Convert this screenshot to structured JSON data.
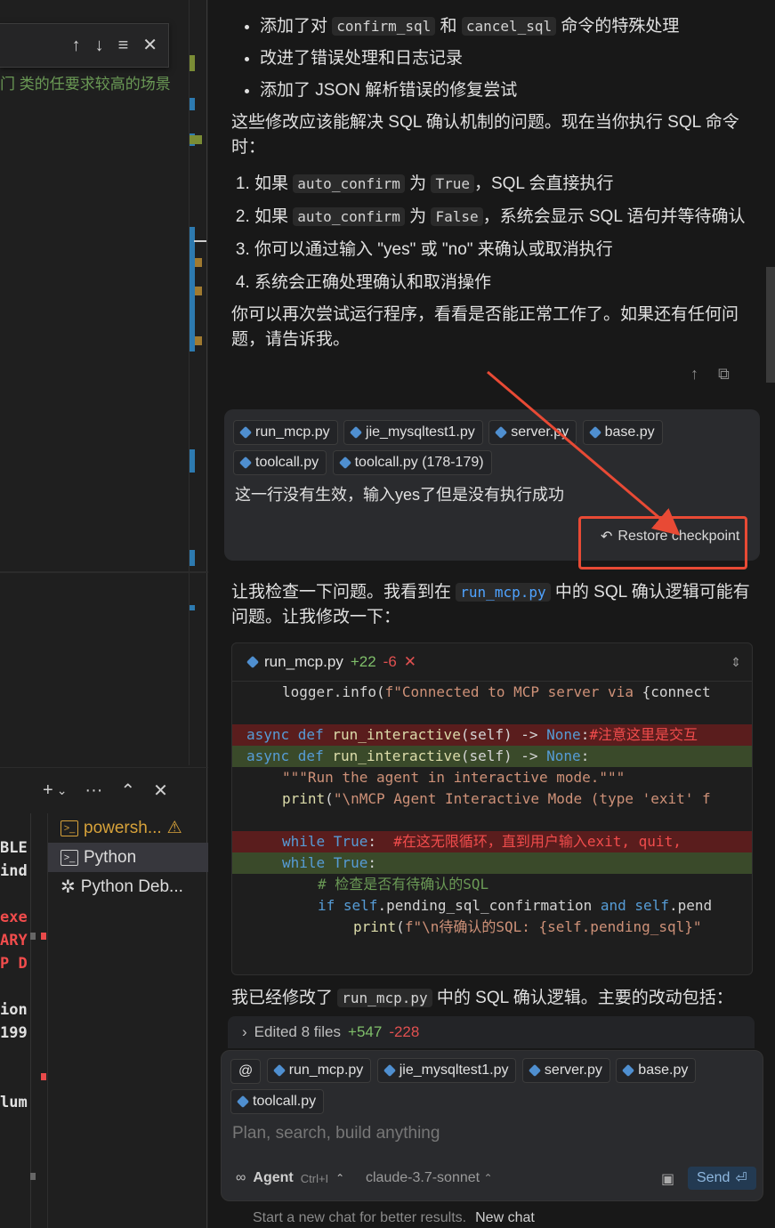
{
  "editor": {
    "snippet": "门 类的任要求较高的场景",
    "find_bar": {
      "up": "↑",
      "down": "↓",
      "menu": "≡",
      "close": "✕"
    },
    "terminal_toolbar": {
      "add": "+",
      "dropdown": "⌄",
      "more": "···",
      "maximize": "⌃",
      "close": "✕"
    },
    "terminal_lines": [
      {
        "text": "BLE",
        "color": "#e0e0e0"
      },
      {
        "text": "ind",
        "color": "#e0e0e0"
      },
      {
        "text": "",
        "color": "#e0e0e0"
      },
      {
        "text": "exe",
        "color": "#f14c4c"
      },
      {
        "text": "ARY",
        "color": "#f14c4c"
      },
      {
        "text": "P D",
        "color": "#f14c4c"
      },
      {
        "text": "",
        "color": "#e0e0e0"
      },
      {
        "text": "ion",
        "color": "#e0e0e0"
      },
      {
        "text": "199",
        "color": "#e0e0e0"
      },
      {
        "text": "",
        "color": "#e0e0e0"
      },
      {
        "text": "",
        "color": "#e0e0e0"
      },
      {
        "text": "lum",
        "color": "#e0e0e0"
      }
    ],
    "terminals": [
      {
        "label": "powersh...",
        "warning": "⚠"
      },
      {
        "label": "Python"
      },
      {
        "label": "Python Deb..."
      }
    ]
  },
  "chat": {
    "bullets": [
      {
        "pre": "添加了对 ",
        "code1": "confirm_sql",
        "mid": " 和 ",
        "code2": "cancel_sql",
        "post": " 命令的特殊处理"
      },
      {
        "text": "改进了错误处理和日志记录"
      },
      {
        "text": "添加了 JSON 解析错误的修复尝试"
      }
    ],
    "para1": "这些修改应该能解决 SQL 确认机制的问题。现在当你执行 SQL 命令时：",
    "steps": [
      {
        "pre": "如果 ",
        "code1": "auto_confirm",
        "mid": " 为 ",
        "code2": "True",
        "post": "，SQL 会直接执行"
      },
      {
        "pre": "如果 ",
        "code1": "auto_confirm",
        "mid": " 为 ",
        "code2": "False",
        "post": "，系统会显示 SQL 语句并等待确认"
      },
      {
        "text": "你可以通过输入 \"yes\" 或 \"no\" 来确认或取消执行"
      },
      {
        "text": "系统会正确处理确认和取消操作"
      }
    ],
    "para2": "你可以再次尝试运行程序，看看是否能正常工作了。如果还有任何问题，请告诉我。",
    "user_message": {
      "files": [
        "run_mcp.py",
        "jie_mysqltest1.py",
        "server.py",
        "base.py",
        "toolcall.py",
        "toolcall.py (178-179)"
      ],
      "text": "这一行没有生效，输入yes了但是没有执行成功",
      "restore": "Restore checkpoint"
    },
    "reply_pre": "让我检查一下问题。我看到在 ",
    "reply_code": "run_mcp.py",
    "reply_post": " 中的 SQL 确认逻辑可能有问题。让我修改一下：",
    "diff": {
      "file": "run_mcp.py",
      "added": "+22",
      "removed": "-6",
      "lines": [
        {
          "type": "ctx",
          "indent": "    ",
          "parts": [
            {
              "c": "",
              "t": "logger.info("
            },
            {
              "c": "str",
              "t": "f\"Connected to MCP server via "
            },
            {
              "c": "",
              "t": "{connect"
            }
          ]
        },
        {
          "type": "ctx",
          "indent": "",
          "parts": []
        },
        {
          "type": "rm",
          "indent": "",
          "parts": [
            {
              "c": "kw",
              "t": "async def "
            },
            {
              "c": "fn",
              "t": "run_interactive"
            },
            {
              "c": "",
              "t": "(self) -> "
            },
            {
              "c": "kw",
              "t": "None"
            },
            {
              "c": "",
              "t": ":"
            },
            {
              "c": "cm-red",
              "t": "#注意这里是交互"
            }
          ]
        },
        {
          "type": "ad",
          "indent": "",
          "parts": [
            {
              "c": "kw",
              "t": "async def "
            },
            {
              "c": "fn",
              "t": "run_interactive"
            },
            {
              "c": "",
              "t": "(self) -> "
            },
            {
              "c": "kw",
              "t": "None"
            },
            {
              "c": "",
              "t": ":"
            }
          ]
        },
        {
          "type": "ctx",
          "indent": "    ",
          "parts": [
            {
              "c": "str",
              "t": "\"\"\"Run the agent in interactive mode.\"\"\""
            }
          ]
        },
        {
          "type": "ctx",
          "indent": "    ",
          "parts": [
            {
              "c": "fn",
              "t": "print"
            },
            {
              "c": "",
              "t": "("
            },
            {
              "c": "str",
              "t": "\"\\nMCP Agent Interactive Mode (type 'exit' f"
            }
          ]
        },
        {
          "type": "ctx",
          "indent": "",
          "parts": []
        },
        {
          "type": "rm",
          "indent": "    ",
          "parts": [
            {
              "c": "kw",
              "t": "while True"
            },
            {
              "c": "",
              "t": ":  "
            },
            {
              "c": "cm-red",
              "t": "#在这无限循环，直到用户输入exit, quit,"
            }
          ]
        },
        {
          "type": "ad",
          "indent": "    ",
          "parts": [
            {
              "c": "kw",
              "t": "while True"
            },
            {
              "c": "",
              "t": ":"
            }
          ]
        },
        {
          "type": "ctx",
          "indent": "        ",
          "parts": [
            {
              "c": "cm",
              "t": "# 检查是否有待确认的SQL"
            }
          ]
        },
        {
          "type": "ctx",
          "indent": "        ",
          "parts": [
            {
              "c": "kw",
              "t": "if "
            },
            {
              "c": "self",
              "t": "self"
            },
            {
              "c": "",
              "t": ".pending_sql_confirmation "
            },
            {
              "c": "kw",
              "t": "and "
            },
            {
              "c": "self",
              "t": "self"
            },
            {
              "c": "",
              "t": ".pend"
            }
          ]
        },
        {
          "type": "ctx",
          "indent": "            ",
          "parts": [
            {
              "c": "fn",
              "t": "print"
            },
            {
              "c": "",
              "t": "("
            },
            {
              "c": "str",
              "t": "f\"\\n待确认的SQL: {self.pending_sql}\""
            }
          ]
        }
      ]
    },
    "summary_pre": "我已经修改了 ",
    "summary_code": "run_mcp.py",
    "summary_post": " 中的 SQL 确认逻辑。主要的改动包括：",
    "edited": {
      "label": "Edited 8 files",
      "added": "+547",
      "removed": "-228"
    },
    "composer": {
      "files": [
        "run_mcp.py",
        "jie_mysqltest1.py",
        "server.py",
        "base.py",
        "toolcall.py"
      ],
      "placeholder": "Plan, search, build anything",
      "mode": "Agent",
      "shortcut": "Ctrl+I",
      "model": "claude-3.7-sonnet",
      "send": "Send"
    },
    "footer": {
      "text": "Start a new chat for better results.",
      "link": "New chat"
    }
  }
}
